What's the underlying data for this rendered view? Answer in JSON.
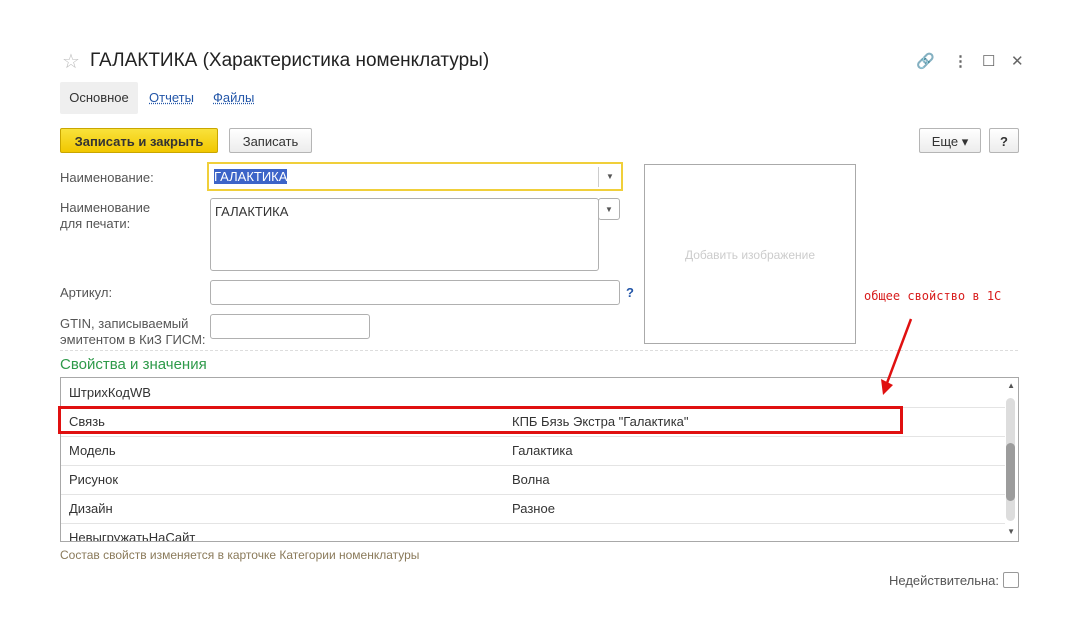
{
  "window": {
    "title": "ГАЛАКТИКА (Характеристика номенклатуры)"
  },
  "tabs": [
    {
      "label": "Основное"
    },
    {
      "label": "Отчеты"
    },
    {
      "label": "Файлы"
    }
  ],
  "toolbar": {
    "save_close": "Записать и закрыть",
    "save": "Записать",
    "more": "Еще",
    "help": "?"
  },
  "form": {
    "name_label": "Наименование:",
    "name_value": "ГАЛАКТИКА",
    "print_label1": "Наименование",
    "print_label2": "для печати:",
    "print_value": "ГАЛАКТИКА",
    "article_label": "Артикул:",
    "article_value": "",
    "article_help": "?",
    "gtin_label1": "GTIN, записываемый",
    "gtin_label2": "эмитентом в КиЗ ГИСМ:",
    "gtin_value": "",
    "image_placeholder": "Добавить изображение"
  },
  "properties": {
    "title": "Свойства и значения",
    "rows": [
      {
        "name": "ШтрихКодWB",
        "value": ""
      },
      {
        "name": "Связь",
        "value": "КПБ Бязь Экстра \"Галактика\""
      },
      {
        "name": "Модель",
        "value": "Галактика"
      },
      {
        "name": "Рисунок",
        "value": "Волна"
      },
      {
        "name": "Дизайн",
        "value": "Разное"
      },
      {
        "name": "НевыгружатьНаСайт",
        "value": ""
      }
    ],
    "note": "Состав свойств изменяется в карточке Категории номенклатуры"
  },
  "invalid_label": "Недействительна:",
  "annotation": "общее свойство в 1С"
}
